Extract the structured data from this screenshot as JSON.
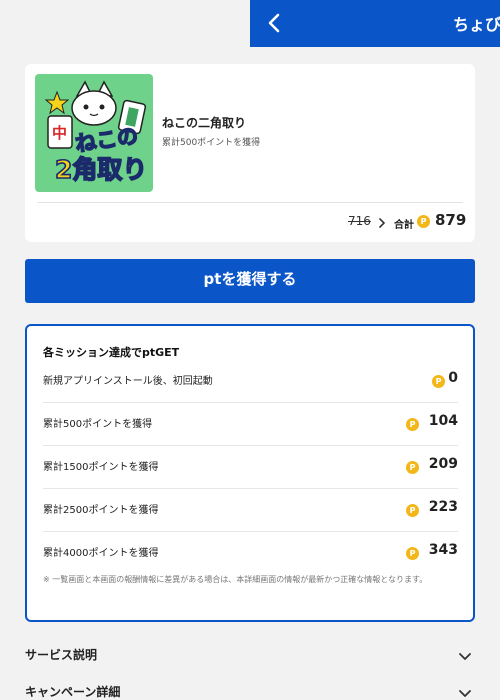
{
  "header": {
    "title": "ちょび"
  },
  "app": {
    "name": "ねこの二角取り",
    "subtitle": "累計500ポイントを獲得",
    "icon_text_small": "ねこの",
    "icon_text_big": "2角取り",
    "icon_tile": "中",
    "old_points": "716",
    "total_label": "合計",
    "total_points": "879"
  },
  "cta": {
    "label": "ptを獲得する"
  },
  "missions": {
    "title": "各ミッション達成でptGET",
    "items": [
      {
        "label": "新規アプリインストール後、初回起動",
        "points": "0"
      },
      {
        "label": "累計500ポイントを獲得",
        "points": "104"
      },
      {
        "label": "累計1500ポイントを獲得",
        "points": "209"
      },
      {
        "label": "累計2500ポイントを獲得",
        "points": "223"
      },
      {
        "label": "累計4000ポイントを獲得",
        "points": "343"
      }
    ],
    "note": "※ 一覧画面と本画面の報酬情報に差異がある場合は、本詳細画面の情報が最新かつ正確な情報となります。"
  },
  "coin_glyph": "P",
  "accordions": [
    {
      "label": "サービス説明"
    },
    {
      "label": "キャンペーン詳細"
    }
  ],
  "colors": {
    "brand_blue": "#0a55c8",
    "coin_gold": "#f3b71a",
    "icon_green": "#6fd28a"
  },
  "icons": [
    "back-arrow-icon",
    "chevron-right-icon",
    "coin-icon",
    "chevron-down-icon"
  ]
}
